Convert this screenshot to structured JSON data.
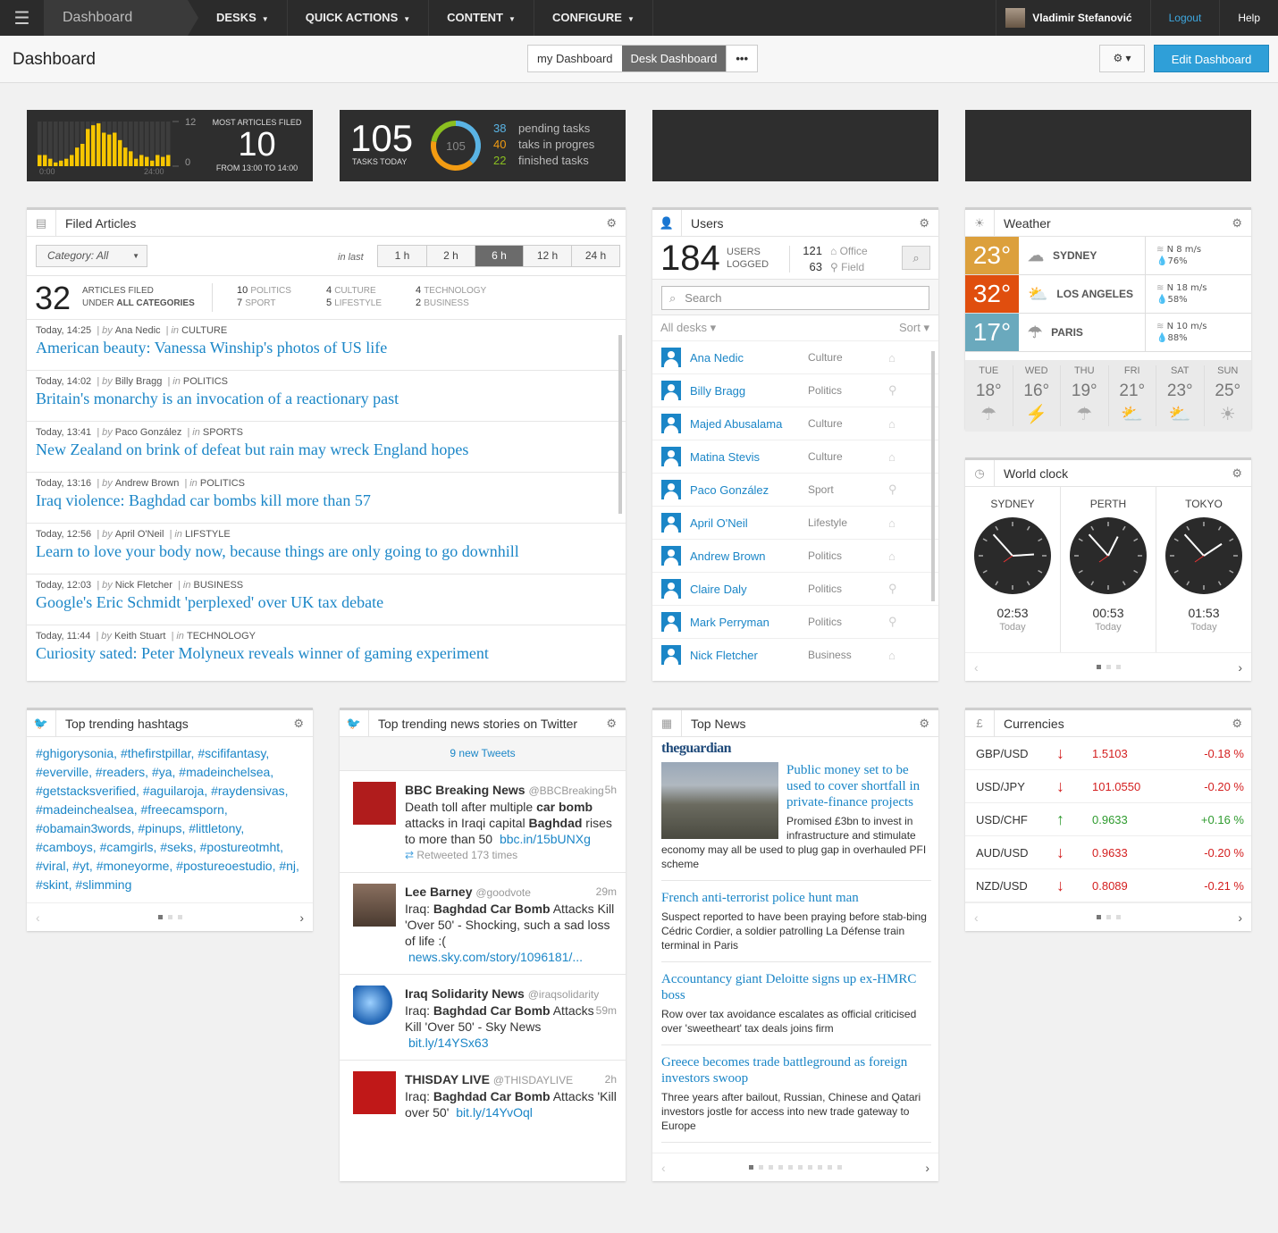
{
  "nav": {
    "brand": "Dashboard",
    "items": [
      "DESKS",
      "QUICK ACTIONS",
      "CONTENT",
      "CONFIGURE"
    ],
    "user": "Vladimir Stefanović",
    "logout": "Logout",
    "help": "Help"
  },
  "header": {
    "title": "Dashboard",
    "tabs": [
      "my Dashboard",
      "Desk Dashboard"
    ],
    "active_tab": "Desk Dashboard",
    "more": "•••",
    "settings": "⚙ ▾",
    "edit": "Edit Dashboard"
  },
  "stats": {
    "articles": {
      "label": "MOST ARTICLES FILED",
      "value": "10",
      "range": "FROM 13:00 TO 14:00",
      "y_max": "12",
      "y_min": "0",
      "x_start": "0:00",
      "x_end": "24:00",
      "accent": "#f7c600",
      "hourly": [
        3,
        3,
        2,
        1,
        1.5,
        2,
        3,
        5,
        6,
        10,
        11,
        11.5,
        9,
        8.5,
        9,
        7,
        5,
        4,
        2,
        3,
        2.5,
        1.5,
        3,
        2.5,
        3
      ]
    },
    "tasks": {
      "total": "105",
      "label": "TASKS TODAY",
      "items": [
        {
          "n": "38",
          "label": "pending tasks",
          "color": "#5ab4e5"
        },
        {
          "n": "40",
          "label": "taks in progres",
          "color": "#f39c12"
        },
        {
          "n": "22",
          "label": "finished tasks",
          "color": "#8bbf20"
        }
      ]
    }
  },
  "filed": {
    "title": "Filed Articles",
    "category": "Category: All",
    "in_last": "in last",
    "ranges": [
      "1 h",
      "2 h",
      "6 h",
      "12 h",
      "24 h"
    ],
    "active_range": "6 h",
    "total": "32",
    "total_l1": "ARTICLES FILED",
    "total_l2": "UNDER",
    "total_l3": "ALL CATEGORIES",
    "cats": [
      {
        "n": "10",
        "c": "POLITICS"
      },
      {
        "n": "7",
        "c": "SPORT"
      },
      {
        "n": "4",
        "c": "CULTURE"
      },
      {
        "n": "5",
        "c": "LIFESTYLE"
      },
      {
        "n": "4",
        "c": "TECHNOLOGY"
      },
      {
        "n": "2",
        "c": "BUSINESS"
      }
    ],
    "articles": [
      {
        "time": "Today, 14:25",
        "by": "Ana Nedic",
        "cat": "CULTURE",
        "title": "American beauty: Vanessa Winship's photos of US life"
      },
      {
        "time": "Today, 14:02",
        "by": "Billy Bragg",
        "cat": "POLITICS",
        "title": "Britain's monarchy is an invocation of a reactionary past"
      },
      {
        "time": "Today, 13:41",
        "by": "Paco González",
        "cat": "SPORTS",
        "title": "New Zealand on brink of defeat but rain may wreck England hopes"
      },
      {
        "time": "Today, 13:16",
        "by": "Andrew Brown",
        "cat": "POLITICS",
        "title": "Iraq violence: Baghdad car bombs kill more than 57"
      },
      {
        "time": "Today, 12:56",
        "by": "April O'Neil",
        "cat": "LIFSTYLE",
        "title": "Learn to love your body now, because things are only going to go downhill"
      },
      {
        "time": "Today, 12:03",
        "by": "Nick Fletcher",
        "cat": "BUSINESS",
        "title": "Google's Eric Schmidt 'perplexed' over UK tax debate"
      },
      {
        "time": "Today, 11:44",
        "by": "Keith Stuart",
        "cat": "TECHNOLOGY",
        "title": "Curiosity sated: Peter Molyneux reveals winner of gaming experiment"
      }
    ]
  },
  "users": {
    "title": "Users",
    "total": "184",
    "l1": "USERS",
    "l2": "LOGGED",
    "office_n": "121",
    "office": "Office",
    "field_n": "63",
    "field": "Field",
    "search_placeholder": "Search",
    "desks": "All desks ▾",
    "sort": "Sort ▾",
    "list": [
      {
        "n": "Ana Nedic",
        "d": "Culture",
        "loc": "office"
      },
      {
        "n": "Billy Bragg",
        "d": "Politics",
        "loc": "field"
      },
      {
        "n": "Majed Abusalama",
        "d": "Culture",
        "loc": "office"
      },
      {
        "n": "Matina Stevis",
        "d": "Culture",
        "loc": "office"
      },
      {
        "n": "Paco González",
        "d": "Sport",
        "loc": "field"
      },
      {
        "n": "April O'Neil",
        "d": "Lifestyle",
        "loc": "office"
      },
      {
        "n": "Andrew Brown",
        "d": "Politics",
        "loc": "office"
      },
      {
        "n": "Claire Daly",
        "d": "Politics",
        "loc": "field"
      },
      {
        "n": "Mark Perryman",
        "d": "Politics",
        "loc": "field"
      },
      {
        "n": "Nick Fletcher",
        "d": "Business",
        "loc": "office"
      }
    ]
  },
  "weather": {
    "title": "Weather",
    "cities": [
      {
        "t": "23°",
        "city": "SYDNEY",
        "wind": "N 8 m/s",
        "hum": "76%",
        "color": "#dca03c",
        "icon": "cloud"
      },
      {
        "t": "32°",
        "city": "LOS ANGELES",
        "wind": "N 18 m/s",
        "hum": "58%",
        "color": "#e04e0e",
        "icon": "partly-sunny"
      },
      {
        "t": "17°",
        "city": "PARIS",
        "wind": "N 10 m/s",
        "hum": "88%",
        "color": "#6aa9bd",
        "icon": "rain"
      }
    ],
    "forecast": [
      {
        "d": "TUE",
        "t": "18°",
        "i": "rain"
      },
      {
        "d": "WED",
        "t": "16°",
        "i": "storm"
      },
      {
        "d": "THU",
        "t": "19°",
        "i": "rain"
      },
      {
        "d": "FRI",
        "t": "21°",
        "i": "partly-sunny"
      },
      {
        "d": "SAT",
        "t": "23°",
        "i": "partly-sunny"
      },
      {
        "d": "SUN",
        "t": "25°",
        "i": "sun"
      }
    ]
  },
  "clock": {
    "title": "World clock",
    "cities": [
      {
        "c": "SYDNEY",
        "t": "02:53",
        "d": "Today"
      },
      {
        "c": "PERTH",
        "t": "00:53",
        "d": "Today"
      },
      {
        "c": "TOKYO",
        "t": "01:53",
        "d": "Today"
      }
    ]
  },
  "hashtags": {
    "title": "Top trending hashtags",
    "text": "#ghigorysonia, #thefirstpillar, #scififantasy, #everville, #readers, #ya, #madeinchelsea, #getstacksverified, #aguilaroja, #raydensivas, #madeinchealsea, #freecamsporn, #obamain3words, #pinups, #littletony, #camboys, #camgirls, #seks, #postureotmht, #viral, #yt, #moneyorme, #postureoestudio, #nj, #skint, #slimming"
  },
  "twitter": {
    "title": "Top trending news stories on Twitter",
    "new": "9 new Tweets",
    "tweets": [
      {
        "name": "BBC Breaking News",
        "handle": "@BBCBreaking",
        "time": "5h",
        "html": "Death toll after multiple <b>car bomb</b> attacks in Iraqi capital <b>Baghdad</b> rises to more than 50",
        "link": "bbc.in/15bUNXg",
        "rt": "Retweeted 173 times",
        "av": "bbc"
      },
      {
        "name": "Lee Barney",
        "handle": "@goodvote",
        "time": "29m",
        "html": "Iraq: <b>Baghdad Car Bomb</b> Attacks Kill 'Over 50' - Shocking, such a sad loss of life :(",
        "link": "news.sky.com/story/1096181/...",
        "av": "person"
      },
      {
        "name": "Iraq Solidarity News",
        "handle": "@iraqsolidarity",
        "time": "59m",
        "html": "Iraq: <b>Baghdad Car Bomb</b> Attacks Kill 'Over 50' - Sky News",
        "link": "bit.ly/14YSx63",
        "av": "globe"
      },
      {
        "name": "THISDAY LIVE",
        "handle": "@THISDAYLIVE",
        "time": "2h",
        "html": "Iraq: <b>Baghdad Car Bomb</b> Attacks 'Kill over 50'",
        "link": "bit.ly/14YvOql",
        "av": "thisday"
      }
    ]
  },
  "topnews": {
    "title": "Top News",
    "source": "theguardian",
    "items": [
      {
        "t": "Public money set to be used to cover shortfall in private-finance projects",
        "d": "Promised £3bn to invest in infrastructure and stimulate economy may all be used to plug gap in overhauled PFI scheme"
      },
      {
        "t": "French anti-terrorist police hunt man",
        "d": "Suspect reported to have been praying before stab-bing Cédric Cordier, a soldier patrolling La Défense train terminal in Paris"
      },
      {
        "t": "Accountancy giant Deloitte signs up ex-HMRC boss",
        "d": "Row over tax avoidance escalates as official criticised over 'sweetheart' tax deals joins firm"
      },
      {
        "t": "Greece becomes trade battleground as foreign investors swoop",
        "d": "Three years after bailout, Russian, Chinese and Qatari investors jostle for access into new trade gateway to Europe"
      }
    ]
  },
  "currencies": {
    "title": "Currencies",
    "rows": [
      {
        "p": "GBP/USD",
        "v": "1.5103",
        "c": "-0.18 %",
        "dir": "down"
      },
      {
        "p": "USD/JPY",
        "v": "101.0550",
        "c": "-0.20 %",
        "dir": "down"
      },
      {
        "p": "USD/CHF",
        "v": "0.9633",
        "c": "+0.16 %",
        "dir": "up"
      },
      {
        "p": "AUD/USD",
        "v": "0.9633",
        "c": "-0.20 %",
        "dir": "down"
      },
      {
        "p": "NZD/USD",
        "v": "0.8089",
        "c": "-0.21 %",
        "dir": "down"
      }
    ],
    "down_color": "#d42020",
    "up_color": "#2e9b2e"
  }
}
